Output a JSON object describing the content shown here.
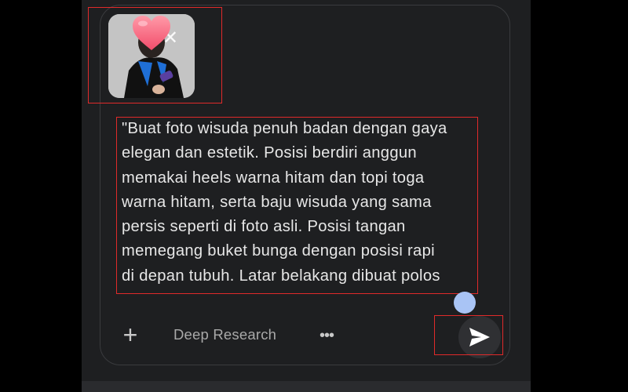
{
  "prompt_lines": [
    "\"Buat foto wisuda penuh badan dengan gaya",
    "elegan dan estetik. Posisi berdiri anggun",
    "memakai heels warna hitam dan topi toga",
    "warna hitam, serta baju wisuda yang sama",
    "persis seperti di foto asli. Posisi tangan",
    "memegang buket bunga dengan posisi rapi",
    "di depan tubuh. Latar belakang dibuat polos"
  ],
  "toolbar": {
    "add_icon": "plus-icon",
    "deep_research_label": "Deep Research",
    "more_icon": "more-horizontal-icon",
    "send_icon": "send-icon"
  },
  "attachment": {
    "remove_icon": "close-icon",
    "overlay_icon": "heart-icon"
  },
  "colors": {
    "background": "#1e1f21",
    "text": "#e7e7e7",
    "annotation": "#e02a2a",
    "touch_indicator": "#a9c4f5"
  }
}
